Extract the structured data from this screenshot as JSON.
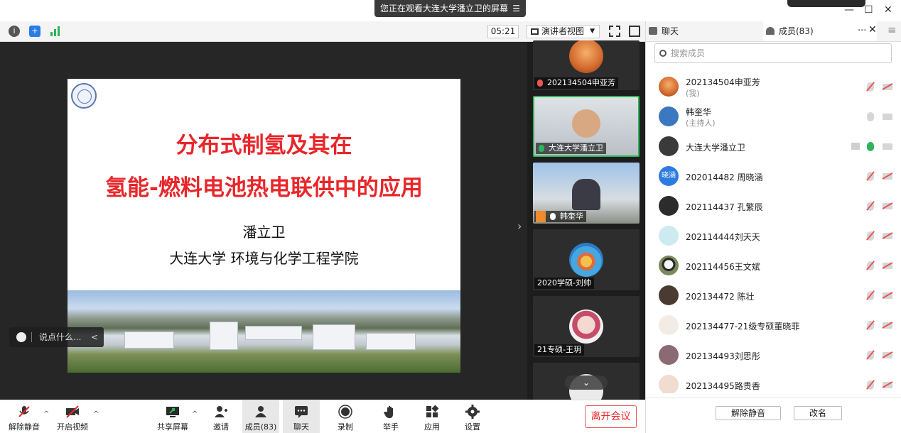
{
  "window": {
    "banner": "您正在观看大连大学潘立卫的屏幕",
    "banner_menu": "☰",
    "minimize": "—",
    "maximize": "☐",
    "close": "✕"
  },
  "toolbar": {
    "timer": "05:21",
    "view_mode": "演讲者视图",
    "view_caret": "▼"
  },
  "slide": {
    "title_line1": "分布式制氢及其在",
    "title_line2": "氢能-燃料电池热电联供中的应用",
    "author": "潘立卫",
    "institution": "大连大学 环境与化学工程学院"
  },
  "chat_input": {
    "placeholder": "说点什么...",
    "collapse": "<"
  },
  "video_tiles": [
    {
      "name": "202134504申亚芳"
    },
    {
      "name": "大连大学潘立卫"
    },
    {
      "name": "韩奎华"
    },
    {
      "name": "2020学硕-刘帅"
    },
    {
      "name": "21专硕-王玥"
    }
  ],
  "bottom_toolbar": {
    "unmute": "解除静音",
    "start_video": "开启视频",
    "share_screen": "共享屏幕",
    "invite": "邀请",
    "members": "成员(83)",
    "chat": "聊天",
    "record": "录制",
    "raise_hand": "举手",
    "apps": "应用",
    "settings": "设置",
    "leave": "离开会议"
  },
  "right_panel": {
    "tab_chat": "聊天",
    "tab_members": "成员(83)",
    "more": "···",
    "close": "✕",
    "menu": "≡",
    "search_placeholder": "搜索成员",
    "members": [
      {
        "name": "202134504申亚芳",
        "role": "(我)"
      },
      {
        "name": "韩奎华",
        "role": "(主持人)"
      },
      {
        "name": "大连大学潘立卫"
      },
      {
        "name": "202014482 周晓涵",
        "avatar_text": "晓涵"
      },
      {
        "name": "202114437 孔繁辰"
      },
      {
        "name": "202114444刘天天"
      },
      {
        "name": "202114456王文斌"
      },
      {
        "name": "202134472 陈壮"
      },
      {
        "name": "202134477-21级专硕董晓菲"
      },
      {
        "name": "202134493刘思彤"
      },
      {
        "name": "202134495路贵香"
      }
    ],
    "footer_unmute": "解除静音",
    "footer_rename": "改名"
  }
}
